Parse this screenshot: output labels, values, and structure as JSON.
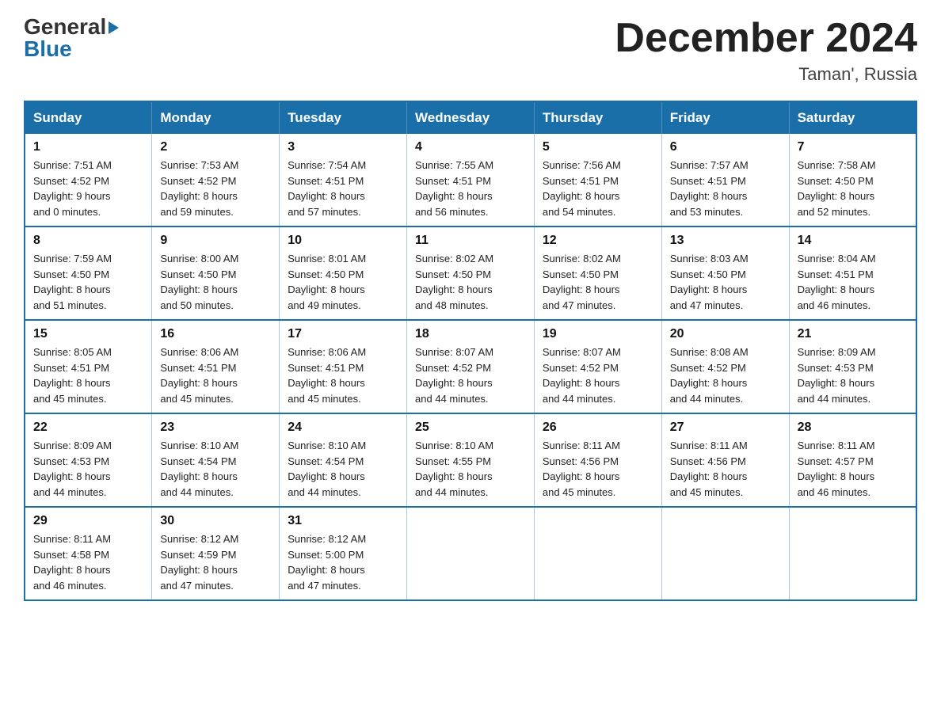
{
  "logo": {
    "general": "General",
    "triangle": "▶",
    "blue": "Blue"
  },
  "title": {
    "month_year": "December 2024",
    "location": "Taman', Russia"
  },
  "headers": [
    "Sunday",
    "Monday",
    "Tuesday",
    "Wednesday",
    "Thursday",
    "Friday",
    "Saturday"
  ],
  "weeks": [
    [
      {
        "day": "1",
        "sunrise": "7:51 AM",
        "sunset": "4:52 PM",
        "daylight": "9 hours and 0 minutes."
      },
      {
        "day": "2",
        "sunrise": "7:53 AM",
        "sunset": "4:52 PM",
        "daylight": "8 hours and 59 minutes."
      },
      {
        "day": "3",
        "sunrise": "7:54 AM",
        "sunset": "4:51 PM",
        "daylight": "8 hours and 57 minutes."
      },
      {
        "day": "4",
        "sunrise": "7:55 AM",
        "sunset": "4:51 PM",
        "daylight": "8 hours and 56 minutes."
      },
      {
        "day": "5",
        "sunrise": "7:56 AM",
        "sunset": "4:51 PM",
        "daylight": "8 hours and 54 minutes."
      },
      {
        "day": "6",
        "sunrise": "7:57 AM",
        "sunset": "4:51 PM",
        "daylight": "8 hours and 53 minutes."
      },
      {
        "day": "7",
        "sunrise": "7:58 AM",
        "sunset": "4:50 PM",
        "daylight": "8 hours and 52 minutes."
      }
    ],
    [
      {
        "day": "8",
        "sunrise": "7:59 AM",
        "sunset": "4:50 PM",
        "daylight": "8 hours and 51 minutes."
      },
      {
        "day": "9",
        "sunrise": "8:00 AM",
        "sunset": "4:50 PM",
        "daylight": "8 hours and 50 minutes."
      },
      {
        "day": "10",
        "sunrise": "8:01 AM",
        "sunset": "4:50 PM",
        "daylight": "8 hours and 49 minutes."
      },
      {
        "day": "11",
        "sunrise": "8:02 AM",
        "sunset": "4:50 PM",
        "daylight": "8 hours and 48 minutes."
      },
      {
        "day": "12",
        "sunrise": "8:02 AM",
        "sunset": "4:50 PM",
        "daylight": "8 hours and 47 minutes."
      },
      {
        "day": "13",
        "sunrise": "8:03 AM",
        "sunset": "4:50 PM",
        "daylight": "8 hours and 47 minutes."
      },
      {
        "day": "14",
        "sunrise": "8:04 AM",
        "sunset": "4:51 PM",
        "daylight": "8 hours and 46 minutes."
      }
    ],
    [
      {
        "day": "15",
        "sunrise": "8:05 AM",
        "sunset": "4:51 PM",
        "daylight": "8 hours and 45 minutes."
      },
      {
        "day": "16",
        "sunrise": "8:06 AM",
        "sunset": "4:51 PM",
        "daylight": "8 hours and 45 minutes."
      },
      {
        "day": "17",
        "sunrise": "8:06 AM",
        "sunset": "4:51 PM",
        "daylight": "8 hours and 45 minutes."
      },
      {
        "day": "18",
        "sunrise": "8:07 AM",
        "sunset": "4:52 PM",
        "daylight": "8 hours and 44 minutes."
      },
      {
        "day": "19",
        "sunrise": "8:07 AM",
        "sunset": "4:52 PM",
        "daylight": "8 hours and 44 minutes."
      },
      {
        "day": "20",
        "sunrise": "8:08 AM",
        "sunset": "4:52 PM",
        "daylight": "8 hours and 44 minutes."
      },
      {
        "day": "21",
        "sunrise": "8:09 AM",
        "sunset": "4:53 PM",
        "daylight": "8 hours and 44 minutes."
      }
    ],
    [
      {
        "day": "22",
        "sunrise": "8:09 AM",
        "sunset": "4:53 PM",
        "daylight": "8 hours and 44 minutes."
      },
      {
        "day": "23",
        "sunrise": "8:10 AM",
        "sunset": "4:54 PM",
        "daylight": "8 hours and 44 minutes."
      },
      {
        "day": "24",
        "sunrise": "8:10 AM",
        "sunset": "4:54 PM",
        "daylight": "8 hours and 44 minutes."
      },
      {
        "day": "25",
        "sunrise": "8:10 AM",
        "sunset": "4:55 PM",
        "daylight": "8 hours and 44 minutes."
      },
      {
        "day": "26",
        "sunrise": "8:11 AM",
        "sunset": "4:56 PM",
        "daylight": "8 hours and 45 minutes."
      },
      {
        "day": "27",
        "sunrise": "8:11 AM",
        "sunset": "4:56 PM",
        "daylight": "8 hours and 45 minutes."
      },
      {
        "day": "28",
        "sunrise": "8:11 AM",
        "sunset": "4:57 PM",
        "daylight": "8 hours and 46 minutes."
      }
    ],
    [
      {
        "day": "29",
        "sunrise": "8:11 AM",
        "sunset": "4:58 PM",
        "daylight": "8 hours and 46 minutes."
      },
      {
        "day": "30",
        "sunrise": "8:12 AM",
        "sunset": "4:59 PM",
        "daylight": "8 hours and 47 minutes."
      },
      {
        "day": "31",
        "sunrise": "8:12 AM",
        "sunset": "5:00 PM",
        "daylight": "8 hours and 47 minutes."
      },
      null,
      null,
      null,
      null
    ]
  ],
  "labels": {
    "sunrise": "Sunrise:",
    "sunset": "Sunset:",
    "daylight": "Daylight:"
  }
}
